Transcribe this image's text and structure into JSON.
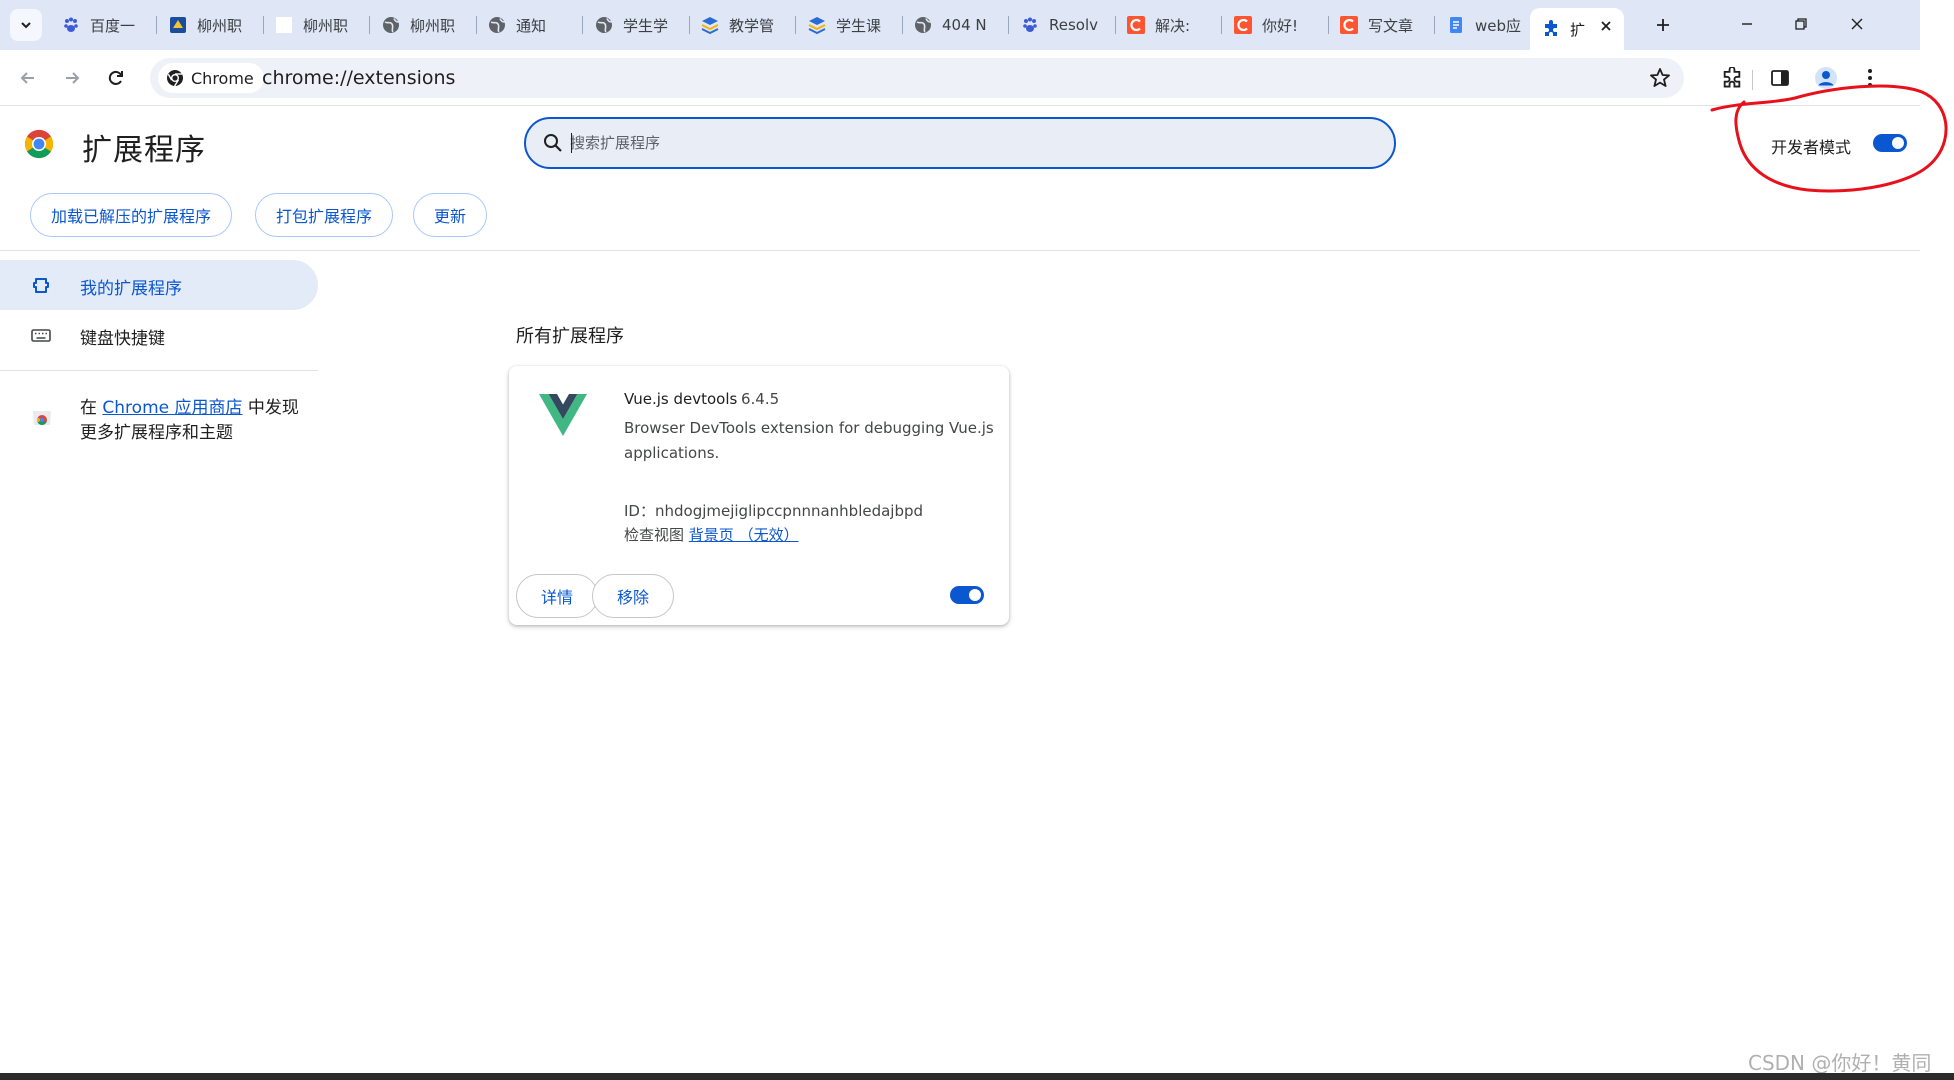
{
  "tabs": [
    {
      "title": "百度一",
      "favicon": "baidu-paw-icon",
      "color": "#3d5bd8"
    },
    {
      "title": "柳州职",
      "favicon": "school-logo-icon",
      "color": "#1b4d9c"
    },
    {
      "title": "柳州职",
      "favicon": "blank-page-icon",
      "color": "#ffffff"
    },
    {
      "title": "柳州职",
      "favicon": "globe-icon",
      "color": "#5f6368"
    },
    {
      "title": "通知",
      "favicon": "globe-icon",
      "color": "#5f6368"
    },
    {
      "title": "学生学",
      "favicon": "globe-icon",
      "color": "#5f6368"
    },
    {
      "title": "教学管",
      "favicon": "app-logo-icon",
      "color": "#2a6bd4"
    },
    {
      "title": "学生课",
      "favicon": "app-logo-icon",
      "color": "#2a6bd4"
    },
    {
      "title": "404 N",
      "favicon": "globe-icon",
      "color": "#5f6368"
    },
    {
      "title": "Resolv",
      "favicon": "baidu-paw-icon",
      "color": "#3d5bd8"
    },
    {
      "title": "解决:",
      "favicon": "csdn-c-icon",
      "color": "#fc5531"
    },
    {
      "title": "你好!",
      "favicon": "csdn-c-icon",
      "color": "#fc5531"
    },
    {
      "title": "写文章",
      "favicon": "csdn-c-icon",
      "color": "#fc5531"
    },
    {
      "title": "web应",
      "favicon": "docs-icon",
      "color": "#4285f4"
    }
  ],
  "active_tab": {
    "title": "扩",
    "favicon": "puzzle-icon",
    "color": "#0b57d0"
  },
  "toolbar": {
    "chip_label": "Chrome",
    "url": "chrome://extensions"
  },
  "header": {
    "title": "扩展程序",
    "search_placeholder": "搜索扩展程序",
    "dev_mode_label": "开发者模式",
    "dev_mode_on": true,
    "buttons": {
      "load_unpacked": "加载已解压的扩展程序",
      "pack": "打包扩展程序",
      "update": "更新"
    }
  },
  "sidebar": {
    "items": [
      {
        "label": "我的扩展程序",
        "icon": "extensions-icon",
        "selected": true
      },
      {
        "label": "键盘快捷键",
        "icon": "keyboard-icon",
        "selected": false
      }
    ],
    "store_prefix": "在 ",
    "store_link": "Chrome 应用商店",
    "store_suffix": " 中发现更多扩展程序和主题"
  },
  "main": {
    "section_title": "所有扩展程序",
    "extensions": [
      {
        "name": "Vue.js devtools",
        "version": "6.4.5",
        "description": "Browser DevTools extension for debugging Vue.js applications.",
        "id_label": "ID：",
        "id": "nhdogjmejiglipccpnnnanhbledajbpd",
        "inspect_label": "检查视图",
        "inspect_link": "背景页 （无效）",
        "details_label": "详情",
        "remove_label": "移除",
        "enabled": true
      }
    ]
  },
  "colors": {
    "accent": "#0b57d0",
    "annotation": "#e8101a",
    "vue_green": "#41b883",
    "vue_dark": "#35495e"
  },
  "watermark": "CSDN @你好！黄同"
}
